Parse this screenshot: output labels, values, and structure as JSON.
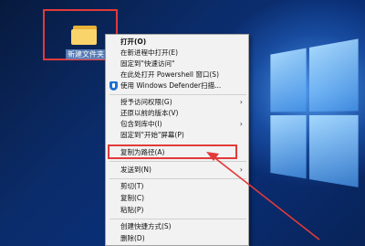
{
  "desktop": {
    "folder_label": "新建文件夹"
  },
  "context_menu": {
    "items": [
      {
        "label": "打开(O)",
        "bold": true,
        "has_submenu": false,
        "icon": ""
      },
      {
        "label": "在新进程中打开(E)",
        "bold": false,
        "has_submenu": false,
        "icon": ""
      },
      {
        "label": "固定到\"快速访问\"",
        "bold": false,
        "has_submenu": false,
        "icon": ""
      },
      {
        "label": "在此处打开 Powershell 窗口(S)",
        "bold": false,
        "has_submenu": false,
        "icon": ""
      },
      {
        "label": "使用 Windows Defender扫描...",
        "bold": false,
        "has_submenu": false,
        "icon": "windows-defender-shield-icon"
      },
      {
        "label": "授予访问权限(G)",
        "bold": false,
        "has_submenu": true,
        "icon": ""
      },
      {
        "label": "还原以前的版本(V)",
        "bold": false,
        "has_submenu": false,
        "icon": ""
      },
      {
        "label": "包含到库中(I)",
        "bold": false,
        "has_submenu": true,
        "icon": ""
      },
      {
        "label": "固定到\"开始\"屏幕(P)",
        "bold": false,
        "has_submenu": false,
        "icon": ""
      },
      {
        "label": "复制为路径(A)",
        "bold": false,
        "has_submenu": false,
        "icon": ""
      },
      {
        "label": "发送到(N)",
        "bold": false,
        "has_submenu": true,
        "icon": ""
      },
      {
        "label": "剪切(T)",
        "bold": false,
        "has_submenu": false,
        "icon": ""
      },
      {
        "label": "复制(C)",
        "bold": false,
        "has_submenu": false,
        "icon": ""
      },
      {
        "label": "粘贴(P)",
        "bold": false,
        "has_submenu": false,
        "icon": ""
      },
      {
        "label": "创建快捷方式(S)",
        "bold": false,
        "has_submenu": false,
        "icon": ""
      },
      {
        "label": "删除(D)",
        "bold": false,
        "has_submenu": false,
        "icon": ""
      }
    ],
    "submenu_arrow": "›"
  },
  "colors": {
    "annotation_red": "#e23a3a",
    "menu_background": "#f2f2f2",
    "defender_blue": "#1d6fd6"
  }
}
